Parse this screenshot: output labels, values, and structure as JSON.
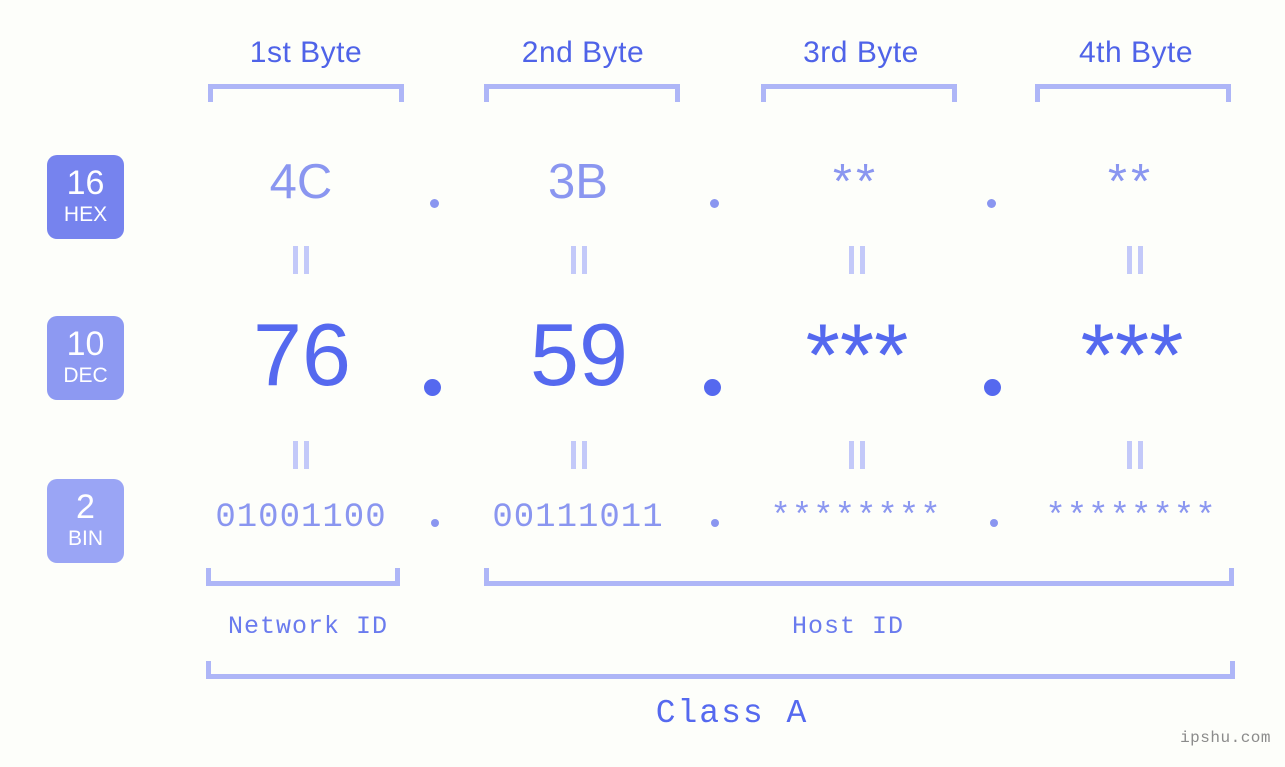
{
  "watermark": "ipshu.com",
  "byte_headers": [
    {
      "label": "1st Byte"
    },
    {
      "label": "2nd Byte"
    },
    {
      "label": "3rd Byte"
    },
    {
      "label": "4th Byte"
    }
  ],
  "bases": [
    {
      "number": "16",
      "unit": "HEX",
      "color": "#7683ee"
    },
    {
      "number": "10",
      "unit": "DEC",
      "color": "#8d99f2"
    },
    {
      "number": "2",
      "unit": "BIN",
      "color": "#9aa5f5"
    }
  ],
  "rows": {
    "hex": {
      "base_number": "16",
      "base_unit": "HEX",
      "values": [
        "4C",
        "3B",
        "**",
        "**"
      ],
      "separator": "."
    },
    "dec": {
      "base_number": "10",
      "base_unit": "DEC",
      "values": [
        "76",
        "59",
        "***",
        "***"
      ],
      "separator": "."
    },
    "bin": {
      "base_number": "2",
      "base_unit": "BIN",
      "values": [
        "01001100",
        "00111011",
        "********",
        "********"
      ],
      "separator": "."
    }
  },
  "equals_marks": {
    "glyph": "="
  },
  "segments": {
    "network_id": "Network ID",
    "host_id": "Host ID",
    "class": "Class A"
  },
  "colors": {
    "background": "#fdfefa",
    "accent_strong": "#5569ef",
    "accent_mid": "#8a96f0",
    "accent_light": "#aeb6f7",
    "badge_hex": "#7683ee",
    "badge_dec": "#8d99f2",
    "badge_bin": "#9aa5f5",
    "watermark": "#8b8b8b"
  }
}
